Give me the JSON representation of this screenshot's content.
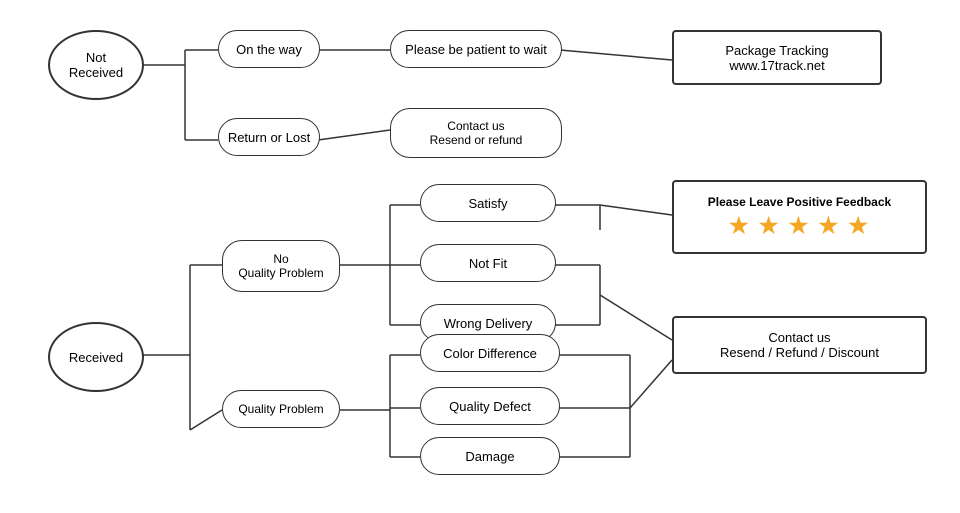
{
  "nodes": {
    "not_received": {
      "label": "Not\nReceived"
    },
    "on_the_way": {
      "label": "On the way"
    },
    "return_or_lost": {
      "label": "Return or Lost"
    },
    "be_patient": {
      "label": "Please be patient to wait"
    },
    "contact_resend": {
      "label": "Contact us\nResend or refund"
    },
    "package_tracking": {
      "label": "Package Tracking\nwww.17track.net"
    },
    "received": {
      "label": "Received"
    },
    "no_quality": {
      "label": "No\nQuality Problem"
    },
    "quality_problem": {
      "label": "Quality Problem"
    },
    "satisfy": {
      "label": "Satisfy"
    },
    "not_fit": {
      "label": "Not Fit"
    },
    "wrong_delivery": {
      "label": "Wrong Delivery"
    },
    "color_diff": {
      "label": "Color Difference"
    },
    "quality_defect": {
      "label": "Quality Defect"
    },
    "damage": {
      "label": "Damage"
    },
    "feedback": {
      "label": "Please Leave Positive Feedback",
      "stars": "★ ★ ★ ★ ★"
    },
    "contact_resend_refund": {
      "label": "Contact us\nResend / Refund / Discount"
    }
  }
}
